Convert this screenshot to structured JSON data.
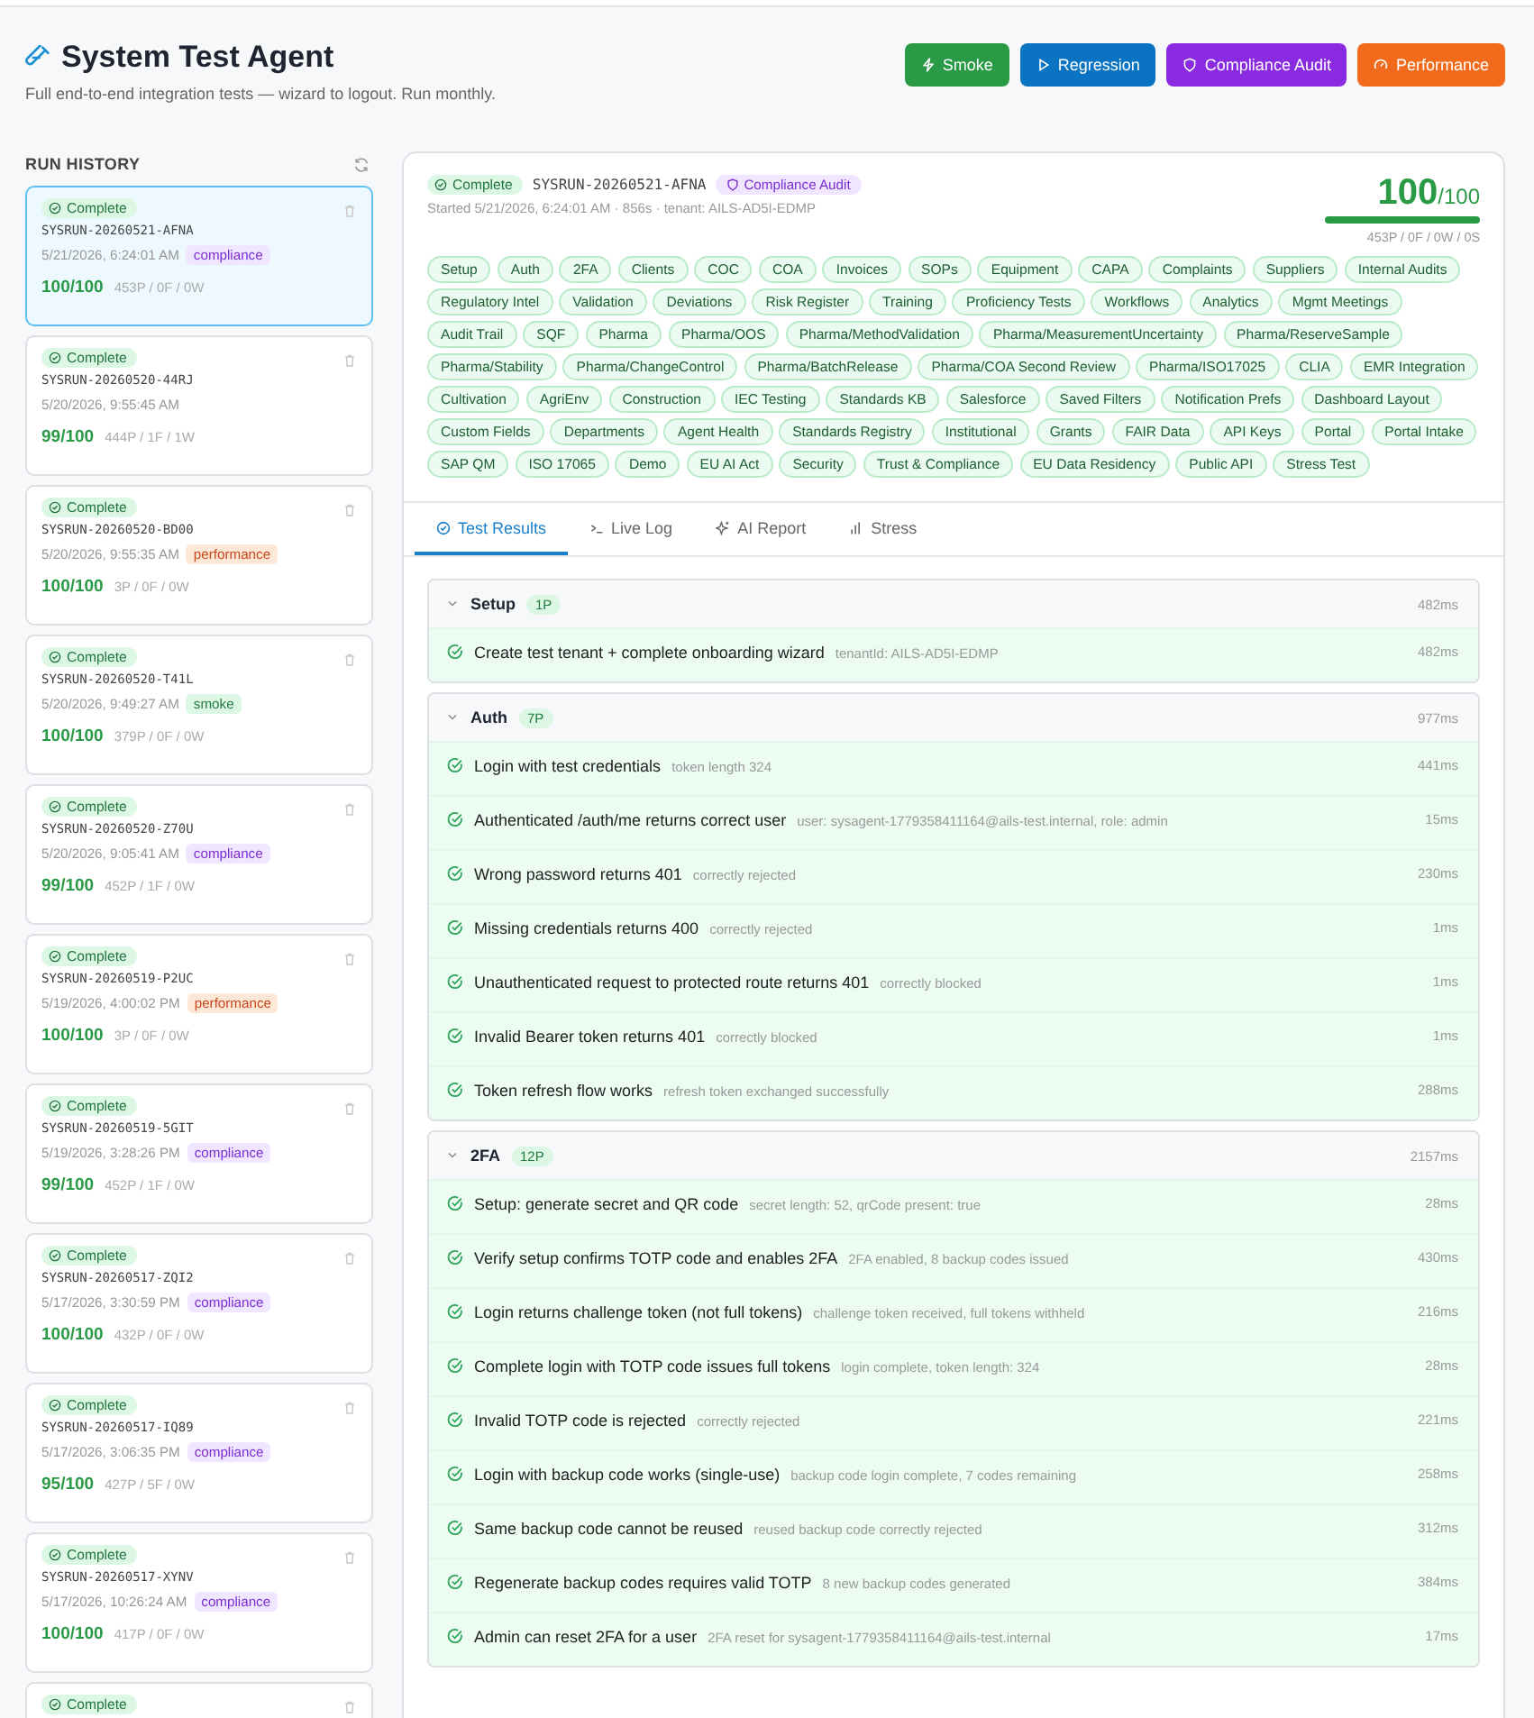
{
  "header": {
    "title": "System Test Agent",
    "subtitle": "Full end-to-end integration tests — wizard to logout. Run monthly.",
    "buttons": [
      {
        "label": "Smoke",
        "kind": "smoke"
      },
      {
        "label": "Regression",
        "kind": "regression"
      },
      {
        "label": "Compliance Audit",
        "kind": "compliance"
      },
      {
        "label": "Performance",
        "kind": "performance"
      }
    ]
  },
  "sidebar": {
    "title": "RUN HISTORY",
    "runs": [
      {
        "status": "Complete",
        "id": "SYSRUN-20260521-AFNA",
        "date": "5/21/2026, 6:24:01 AM",
        "tag": {
          "label": "compliance",
          "kind": "compliance"
        },
        "score": "100/100",
        "counts": "453P / 0F / 0W",
        "selected": true
      },
      {
        "status": "Complete",
        "id": "SYSRUN-20260520-44RJ",
        "date": "5/20/2026, 9:55:45 AM",
        "score": "99/100",
        "counts": "444P / 1F / 1W",
        "selected": false
      },
      {
        "status": "Complete",
        "id": "SYSRUN-20260520-BD00",
        "date": "5/20/2026, 9:55:35 AM",
        "tag": {
          "label": "performance",
          "kind": "performance"
        },
        "score": "100/100",
        "counts": "3P / 0F / 0W",
        "selected": false
      },
      {
        "status": "Complete",
        "id": "SYSRUN-20260520-T41L",
        "date": "5/20/2026, 9:49:27 AM",
        "tag": {
          "label": "smoke",
          "kind": "smoke"
        },
        "score": "100/100",
        "counts": "379P / 0F / 0W",
        "selected": false
      },
      {
        "status": "Complete",
        "id": "SYSRUN-20260520-Z70U",
        "date": "5/20/2026, 9:05:41 AM",
        "tag": {
          "label": "compliance",
          "kind": "compliance"
        },
        "score": "99/100",
        "counts": "452P / 1F / 0W",
        "selected": false
      },
      {
        "status": "Complete",
        "id": "SYSRUN-20260519-P2UC",
        "date": "5/19/2026, 4:00:02 PM",
        "tag": {
          "label": "performance",
          "kind": "performance"
        },
        "score": "100/100",
        "counts": "3P / 0F / 0W",
        "selected": false
      },
      {
        "status": "Complete",
        "id": "SYSRUN-20260519-5GIT",
        "date": "5/19/2026, 3:28:26 PM",
        "tag": {
          "label": "compliance",
          "kind": "compliance"
        },
        "score": "99/100",
        "counts": "452P / 1F / 0W",
        "selected": false
      },
      {
        "status": "Complete",
        "id": "SYSRUN-20260517-ZQI2",
        "date": "5/17/2026, 3:30:59 PM",
        "tag": {
          "label": "compliance",
          "kind": "compliance"
        },
        "score": "100/100",
        "counts": "432P / 0F / 0W",
        "selected": false
      },
      {
        "status": "Complete",
        "id": "SYSRUN-20260517-IQ89",
        "date": "5/17/2026, 3:06:35 PM",
        "tag": {
          "label": "compliance",
          "kind": "compliance"
        },
        "score": "95/100",
        "counts": "427P / 5F / 0W",
        "selected": false
      },
      {
        "status": "Complete",
        "id": "SYSRUN-20260517-XYNV",
        "date": "5/17/2026, 10:26:24 AM",
        "tag": {
          "label": "compliance",
          "kind": "compliance"
        },
        "score": "100/100",
        "counts": "417P / 0F / 0W",
        "selected": false
      },
      {
        "status": "Complete",
        "selected": false
      }
    ]
  },
  "run": {
    "status": "Complete",
    "id": "SYSRUN-20260521-AFNA",
    "type": {
      "label": "Compliance Audit",
      "kind": "compliance"
    },
    "meta": "Started 5/21/2026, 6:24:01 AM · 856s · tenant: AILS-AD5I-EDMP",
    "score": "100",
    "score_max": "/100",
    "level": 1,
    "summary": "453P / 0F / 0W / 0S",
    "suites": [
      "Setup",
      "Auth",
      "2FA",
      "Clients",
      "COC",
      "COA",
      "Invoices",
      "SOPs",
      "Equipment",
      "CAPA",
      "Complaints",
      "Suppliers",
      "Internal Audits",
      "Regulatory Intel",
      "Validation",
      "Deviations",
      "Risk Register",
      "Training",
      "Proficiency Tests",
      "Workflows",
      "Analytics",
      "Mgmt Meetings",
      "Audit Trail",
      "SQF",
      "Pharma",
      "Pharma/OOS",
      "Pharma/MethodValidation",
      "Pharma/MeasurementUncertainty",
      "Pharma/ReserveSample",
      "Pharma/Stability",
      "Pharma/ChangeControl",
      "Pharma/BatchRelease",
      "Pharma/COA Second Review",
      "Pharma/ISO17025",
      "CLIA",
      "EMR Integration",
      "Cultivation",
      "AgriEnv",
      "Construction",
      "IEC Testing",
      "Standards KB",
      "Salesforce",
      "Saved Filters",
      "Notification Prefs",
      "Dashboard Layout",
      "Custom Fields",
      "Departments",
      "Agent Health",
      "Standards Registry",
      "Institutional",
      "Grants",
      "FAIR Data",
      "API Keys",
      "Portal",
      "Portal Intake",
      "SAP QM",
      "ISO 17065",
      "Demo",
      "EU AI Act",
      "Security",
      "Trust & Compliance",
      "EU Data Residency",
      "Public API",
      "Stress Test"
    ]
  },
  "tabs": [
    {
      "label": "Test Results",
      "kind": "results",
      "selected": true
    },
    {
      "label": "Live Log",
      "kind": "log",
      "selected": false
    },
    {
      "label": "AI Report",
      "kind": "ai",
      "selected": false
    },
    {
      "label": "Stress",
      "kind": "stress",
      "selected": false
    }
  ],
  "groups": [
    {
      "name": "Setup",
      "count": "1P",
      "duration": "482ms",
      "expanded": true,
      "tests": [
        {
          "name": "Create test tenant + complete onboarding wizard",
          "detail": "tenantId: AILS-AD5I-EDMP",
          "duration": "482ms",
          "passed": true
        }
      ]
    },
    {
      "name": "Auth",
      "count": "7P",
      "duration": "977ms",
      "expanded": true,
      "tests": [
        {
          "name": "Login with test credentials",
          "detail": "token length 324",
          "duration": "441ms",
          "passed": true
        },
        {
          "name": "Authenticated /auth/me returns correct user",
          "detail": "user: sysagent-1779358411164@ails-test.internal, role: admin",
          "duration": "15ms",
          "passed": true
        },
        {
          "name": "Wrong password returns 401",
          "detail": "correctly rejected",
          "duration": "230ms",
          "passed": true
        },
        {
          "name": "Missing credentials returns 400",
          "detail": "correctly rejected",
          "duration": "1ms",
          "passed": true
        },
        {
          "name": "Unauthenticated request to protected route returns 401",
          "detail": "correctly blocked",
          "duration": "1ms",
          "passed": true
        },
        {
          "name": "Invalid Bearer token returns 401",
          "detail": "correctly blocked",
          "duration": "1ms",
          "passed": true
        },
        {
          "name": "Token refresh flow works",
          "detail": "refresh token exchanged successfully",
          "duration": "288ms",
          "passed": true
        }
      ]
    },
    {
      "name": "2FA",
      "count": "12P",
      "duration": "2157ms",
      "expanded": true,
      "tests": [
        {
          "name": "Setup: generate secret and QR code",
          "detail": "secret length: 52, qrCode present: true",
          "duration": "28ms",
          "passed": true
        },
        {
          "name": "Verify setup confirms TOTP code and enables 2FA",
          "detail": "2FA enabled, 8 backup codes issued",
          "duration": "430ms",
          "passed": true
        },
        {
          "name": "Login returns challenge token (not full tokens)",
          "detail": "challenge token received, full tokens withheld",
          "duration": "216ms",
          "passed": true
        },
        {
          "name": "Complete login with TOTP code issues full tokens",
          "detail": "login complete, token length: 324",
          "duration": "28ms",
          "passed": true
        },
        {
          "name": "Invalid TOTP code is rejected",
          "detail": "correctly rejected",
          "duration": "221ms",
          "passed": true
        },
        {
          "name": "Login with backup code works (single-use)",
          "detail": "backup code login complete, 7 codes remaining",
          "duration": "258ms",
          "passed": true
        },
        {
          "name": "Same backup code cannot be reused",
          "detail": "reused backup code correctly rejected",
          "duration": "312ms",
          "passed": true
        },
        {
          "name": "Regenerate backup codes requires valid TOTP",
          "detail": "8 new backup codes generated",
          "duration": "384ms",
          "passed": true
        },
        {
          "name": "Admin can reset 2FA for a user",
          "detail": "2FA reset for sysagent-1779358411164@ails-test.internal",
          "duration": "17ms",
          "passed": true
        }
      ]
    }
  ]
}
